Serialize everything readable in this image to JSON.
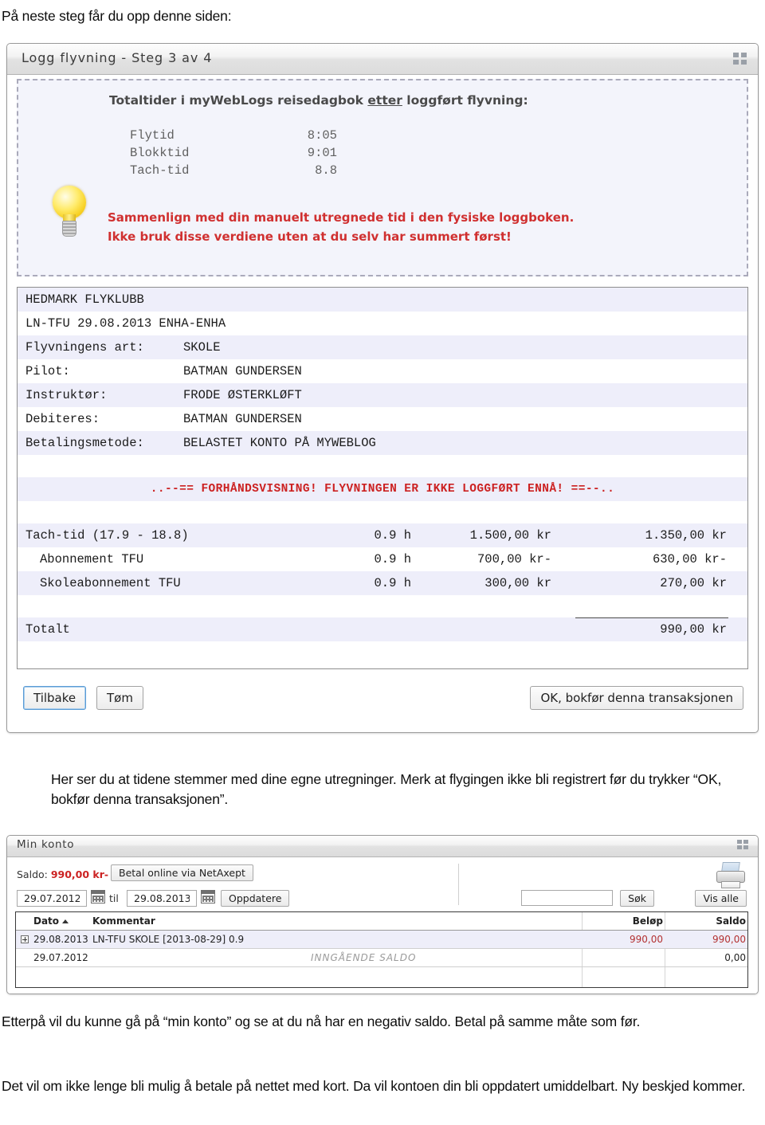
{
  "document": {
    "intro_text": "På neste steg får du opp denne siden:",
    "mid_text": "Her ser du at tidene stemmer med dine egne utregninger. Merk at flygingen ikke bli registrert før du trykker “OK, bokfør denna transaksjonen”.",
    "after_text": "Etterpå vil du kunne gå på “min konto” og se at du nå har en negativ saldo. Betal på samme måte som før.",
    "final_text": "Det vil om ikke lenge bli mulig å betale på nettet med kort. Da vil kontoen din bli oppdatert umiddelbart. Ny beskjed kommer."
  },
  "logg_window": {
    "title": "Logg flyvning - Steg 3 av 4",
    "grid_icon": "grid-icon",
    "hint": {
      "bulb_icon": "lightbulb-icon",
      "heading_before": "Totaltider i myWebLogs reisedagbok ",
      "heading_underlined": "etter",
      "heading_after": " loggført flyvning:",
      "times": [
        {
          "label": "Flytid",
          "value": "8:05"
        },
        {
          "label": "Blokktid",
          "value": "9:01"
        },
        {
          "label": "Tach-tid",
          "value": "8.8"
        }
      ],
      "warning_line1": "Sammenlign med din manuelt utregnede tid i den fysiske loggboken.",
      "warning_line2": "Ikke bruk disse verdiene uten at du selv har summert først!",
      "warning_color": "#d03030"
    },
    "receipt": {
      "club": "HEDMARK FLYKLUBB",
      "flight_line": "LN-TFU 29.08.2013 ENHA-ENHA",
      "fields": [
        {
          "label": "Flyvningens art:",
          "value": "SKOLE"
        },
        {
          "label": "Pilot:",
          "value": "BATMAN GUNDERSEN"
        },
        {
          "label": "Instruktør:",
          "value": "FRODE ØSTERKLØFT"
        },
        {
          "label": "Debiteres:",
          "value": "BATMAN GUNDERSEN"
        },
        {
          "label": "Betalingsmetode:",
          "value": "BELASTET KONTO PÅ MYWEBLOG"
        }
      ],
      "preview_banner": "..--== FORHÅNDSVISNING! FLYVNINGEN ER IKKE LOGGFØRT ENNÅ! ==--..",
      "preview_color": "#cc2222",
      "lines": [
        {
          "desc": "Tach-tid (17.9 - 18.8)",
          "qty": "0.9 h",
          "price": "1.500,00 kr",
          "sum": "1.350,00 kr",
          "indent": false
        },
        {
          "desc": "Abonnement TFU",
          "qty": "0.9 h",
          "price": "700,00 kr-",
          "sum": "630,00 kr-",
          "indent": true
        },
        {
          "desc": "Skoleabonnement TFU",
          "qty": "0.9 h",
          "price": "300,00 kr",
          "sum": "270,00 kr",
          "indent": true
        }
      ],
      "total_label": "Totalt",
      "total_value": "990,00 kr"
    },
    "buttons": {
      "back": "Tilbake",
      "clear": "Tøm",
      "confirm": "OK, bokfør denna transaksjonen"
    }
  },
  "konto_window": {
    "title": "Min konto",
    "grid_icon": "grid-icon",
    "printer_icon": "printer-icon",
    "saldo_label": "Saldo: ",
    "saldo_value": "990,00 kr-",
    "saldo_color": "#cc2222",
    "pay_button": "Betal online via NetAxept",
    "date_from": "29.07.2012",
    "date_between": "til",
    "date_to": "29.08.2013",
    "update_button": "Oppdatere",
    "calendar_icon": "calendar-icon",
    "search_value": "",
    "search_button": "Søk",
    "showall_button": "Vis alle",
    "table": {
      "columns": [
        "Dato",
        "Kommentar",
        "Beløp",
        "Saldo"
      ],
      "sort_column": "Dato",
      "sort_direction": "asc",
      "rows": [
        {
          "expandable": true,
          "date": "29.08.2013",
          "comment": "LN-TFU SKOLE [2013-08-29] 0.9",
          "italic_note": "",
          "amount": "990,00",
          "balance": "990,00",
          "amount_color": "#b33131"
        },
        {
          "expandable": false,
          "date": "29.07.2012",
          "comment": "",
          "italic_note": "INNGÅENDE SALDO",
          "amount": "",
          "balance": "0,00",
          "amount_color": "#222222"
        }
      ]
    }
  }
}
